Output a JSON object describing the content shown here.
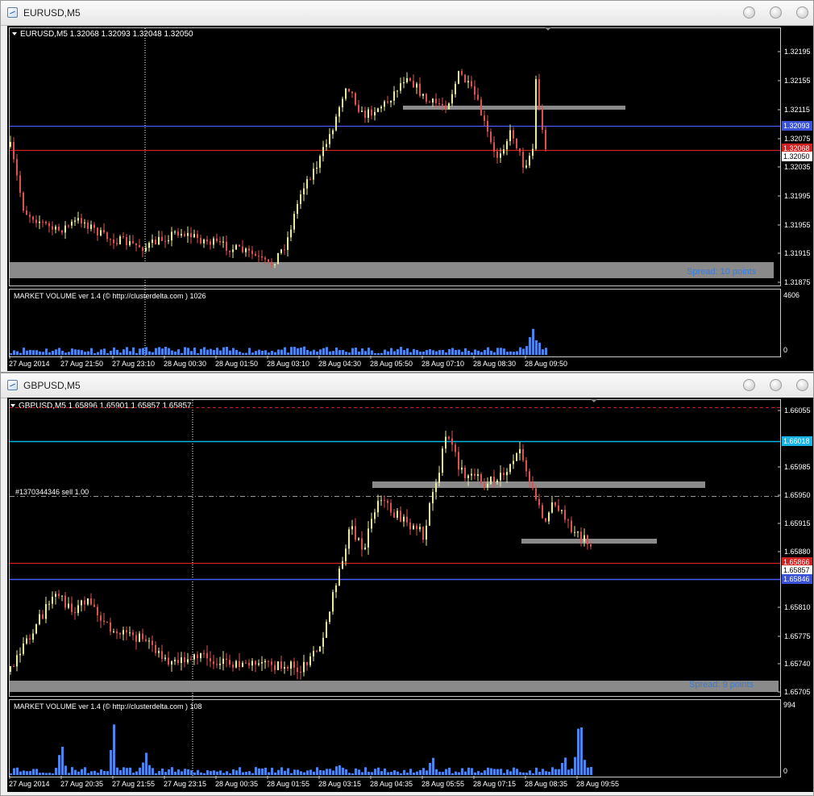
{
  "windows": [
    {
      "title": "EURUSD,M5",
      "header": "EURUSD,M5  1.32068 1.32093 1.32048 1.32050",
      "price_labels": [
        "1.32195",
        "1.32155",
        "1.32115",
        "1.32075",
        "1.32035",
        "1.31995",
        "1.31955",
        "1.31915",
        "1.31875"
      ],
      "markers": [
        {
          "text": "1.32093",
          "kind": "blue"
        },
        {
          "text": "1.32068",
          "kind": "red"
        },
        {
          "text": "1.32050",
          "kind": "white"
        }
      ],
      "spread_label": "Spread: 10 points",
      "volume_label": "MARKET VOLUME ver 1.4 (© http://clusterdelta.com ) 1026",
      "volume_max": "4606",
      "volume_min": "0",
      "time_labels": [
        "27 Aug 2014",
        "27 Aug 21:50",
        "27 Aug 23:10",
        "28 Aug 00:30",
        "28 Aug 01:50",
        "28 Aug 03:10",
        "28 Aug 04:30",
        "28 Aug 05:50",
        "28 Aug 07:10",
        "28 Aug 08:30",
        "28 Aug 09:50"
      ]
    },
    {
      "title": "GBPUSD,M5",
      "header": "GBPUSD,M5  1.65896 1.65901 1.65857 1.65857",
      "order_label": "#1370344346 sell 1.00",
      "price_labels": [
        "1.66055",
        "1.65985",
        "1.65950",
        "1.65915",
        "1.65880",
        "1.65810",
        "1.65775",
        "1.65740",
        "1.65705"
      ],
      "markers": [
        {
          "text": "1.66018",
          "kind": "cyan"
        },
        {
          "text": "1.65866",
          "kind": "red"
        },
        {
          "text": "1.65857",
          "kind": "white"
        },
        {
          "text": "1.65846",
          "kind": "blue"
        }
      ],
      "spread_label": "Spread: 9 points",
      "volume_label": "MARKET VOLUME ver 1.4 (© http://clusterdelta.com ) 108",
      "volume_max": "994",
      "volume_min": "0",
      "time_labels": [
        "27 Aug 2014",
        "27 Aug 20:35",
        "27 Aug 21:55",
        "27 Aug 23:15",
        "28 Aug 00:35",
        "28 Aug 01:55",
        "28 Aug 03:15",
        "28 Aug 04:35",
        "28 Aug 05:55",
        "28 Aug 07:15",
        "28 Aug 08:35",
        "28 Aug 09:55"
      ]
    }
  ],
  "colors": {
    "bull": "#e8e8a0",
    "bear": "#e05050",
    "volume": "#4a86e8",
    "spread": "#3a7bd5"
  }
}
